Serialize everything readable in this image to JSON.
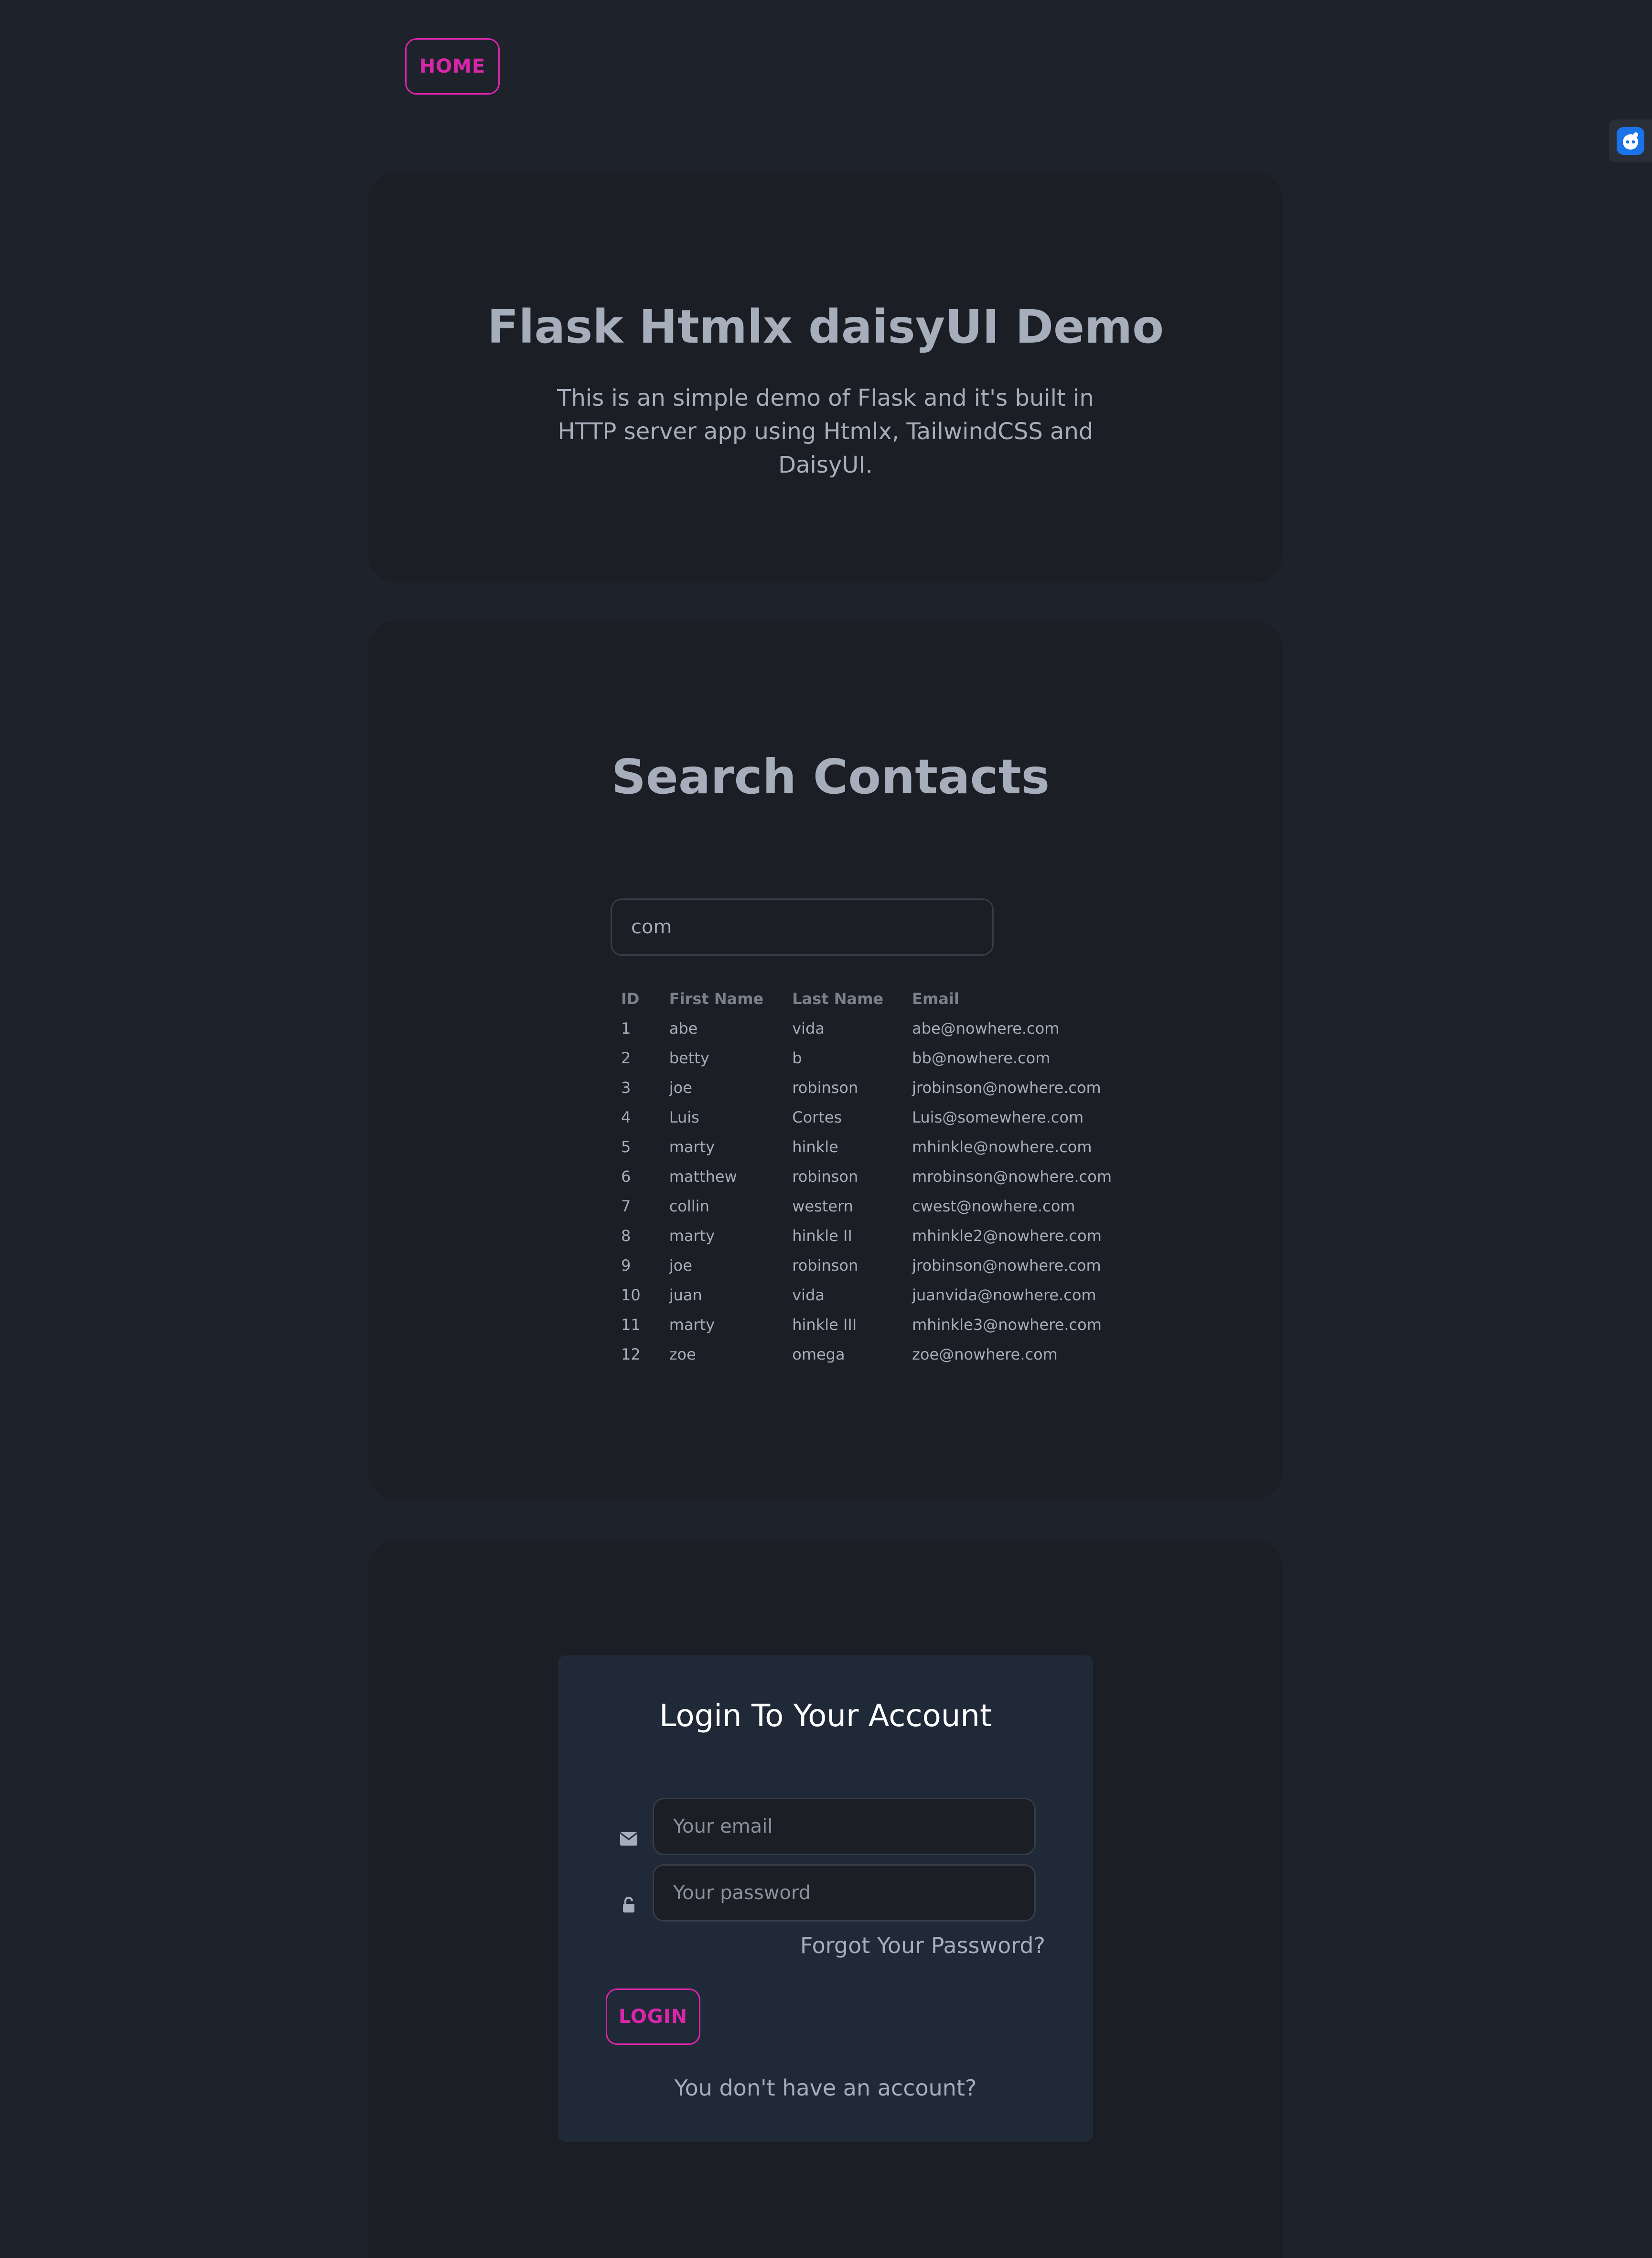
{
  "nav": {
    "home_label": "HOME"
  },
  "extension": {
    "icon": "robot-face-icon"
  },
  "hero": {
    "title": "Flask Htmlx daisyUI Demo",
    "description": "This is an simple demo of Flask and it's built in HTTP server app using Htmlx, TailwindCSS and DaisyUI."
  },
  "search": {
    "title": "Search Contacts",
    "query": "com",
    "columns": [
      "ID",
      "First Name",
      "Last Name",
      "Email"
    ],
    "rows": [
      [
        "1",
        "abe",
        "vida",
        "abe@nowhere.com"
      ],
      [
        "2",
        "betty",
        "b",
        "bb@nowhere.com"
      ],
      [
        "3",
        "joe",
        "robinson",
        "jrobinson@nowhere.com"
      ],
      [
        "4",
        "Luis",
        "Cortes",
        "Luis@somewhere.com"
      ],
      [
        "5",
        "marty",
        "hinkle",
        "mhinkle@nowhere.com"
      ],
      [
        "6",
        "matthew",
        "robinson",
        "mrobinson@nowhere.com"
      ],
      [
        "7",
        "collin",
        "western",
        "cwest@nowhere.com"
      ],
      [
        "8",
        "marty",
        "hinkle II",
        "mhinkle2@nowhere.com"
      ],
      [
        "9",
        "joe",
        "robinson",
        "jrobinson@nowhere.com"
      ],
      [
        "10",
        "juan",
        "vida",
        "juanvida@nowhere.com"
      ],
      [
        "11",
        "marty",
        "hinkle III",
        "mhinkle3@nowhere.com"
      ],
      [
        "12",
        "zoe",
        "omega",
        "zoe@nowhere.com"
      ]
    ]
  },
  "login": {
    "title": "Login To Your Account",
    "email_placeholder": "Your email",
    "email_icon": "envelope-icon",
    "password_placeholder": "Your password",
    "password_icon": "unlock-icon",
    "forgot_label": "Forgot Your Password?",
    "login_label": "LOGIN",
    "signup_label": "You don't have an account?"
  },
  "colors": {
    "accent": "#d926a9",
    "background": "#1e222a",
    "card": "#1b1e24",
    "login_card": "#1f2937"
  }
}
